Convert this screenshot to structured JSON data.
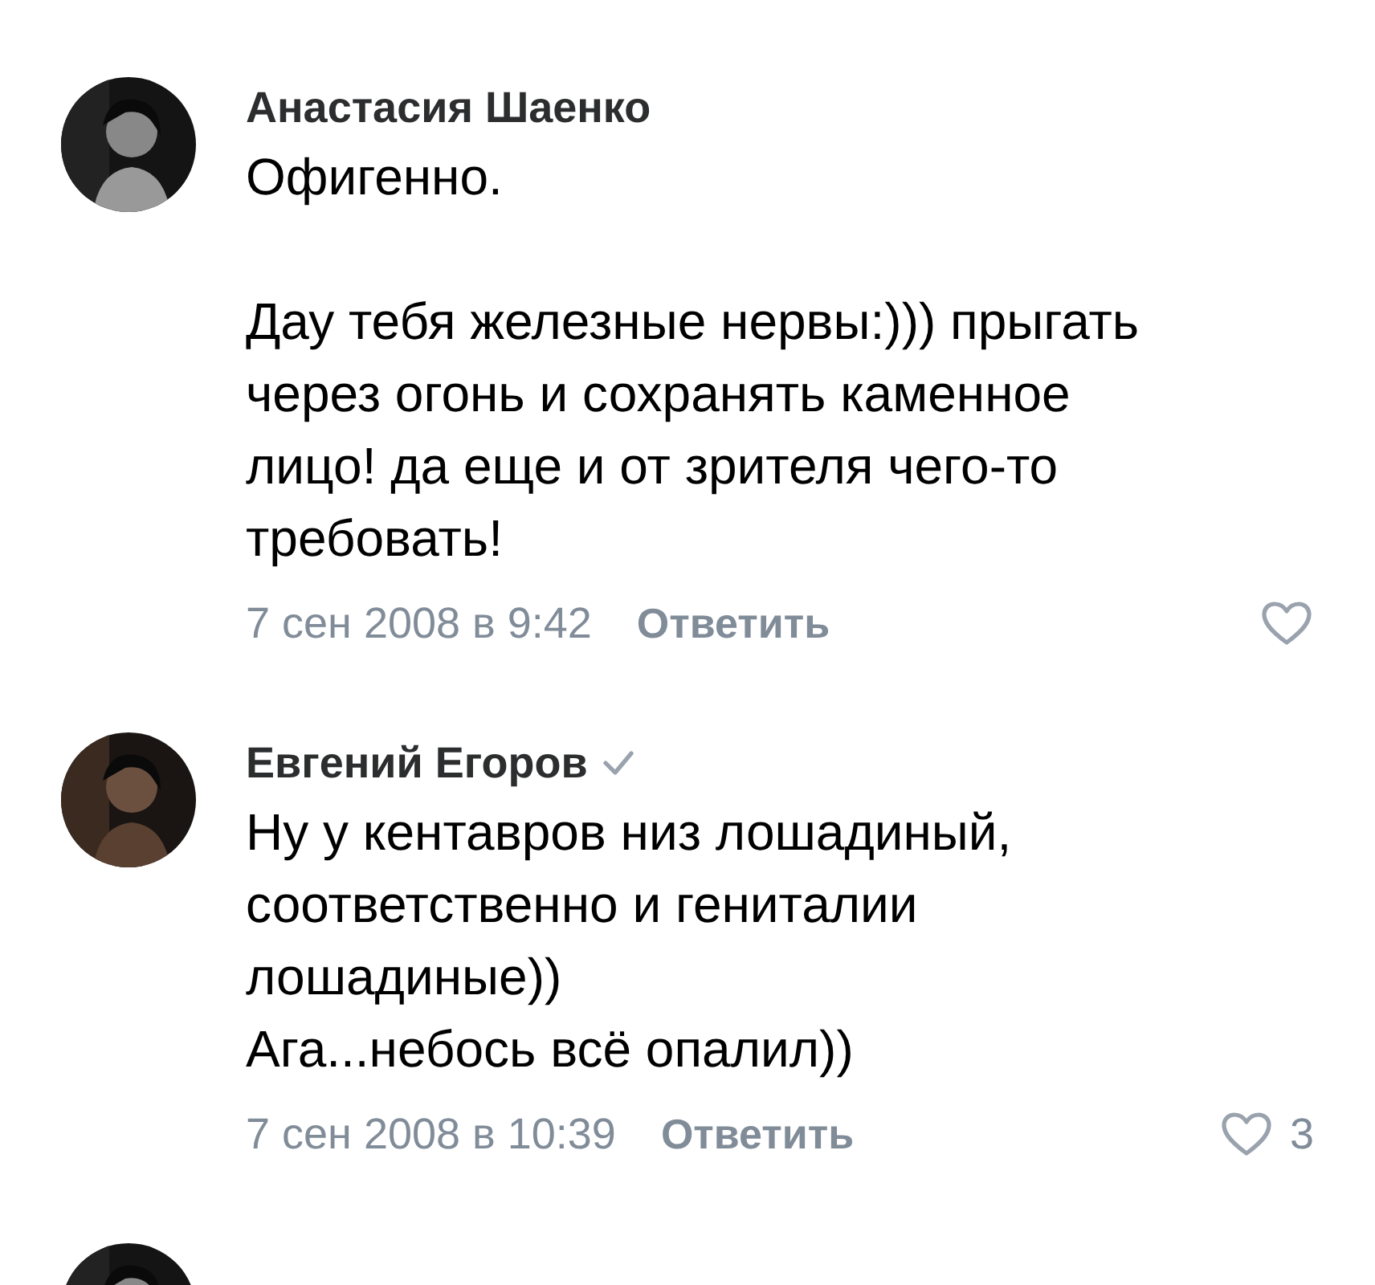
{
  "comments": [
    {
      "author": "Анастасия Шаенко",
      "verified": false,
      "text": "Офигенно.\n\nДау тебя железные нервы:))) прыгать через огонь и сохранять каменное лицо! да еще и от зрителя чего-то требовать!",
      "date": "7 сен 2008 в 9:42",
      "reply": "Ответить",
      "liked": false
    },
    {
      "author": "Евгений Егоров",
      "verified": true,
      "text": "Ну у кентавров низ лошадиный, соответственно и гениталии лошадиные))\nАга...небось всё опалил))",
      "date": "7 сен 2008 в 10:39",
      "reply": "Ответить",
      "liked": false,
      "likes": "3"
    }
  ]
}
